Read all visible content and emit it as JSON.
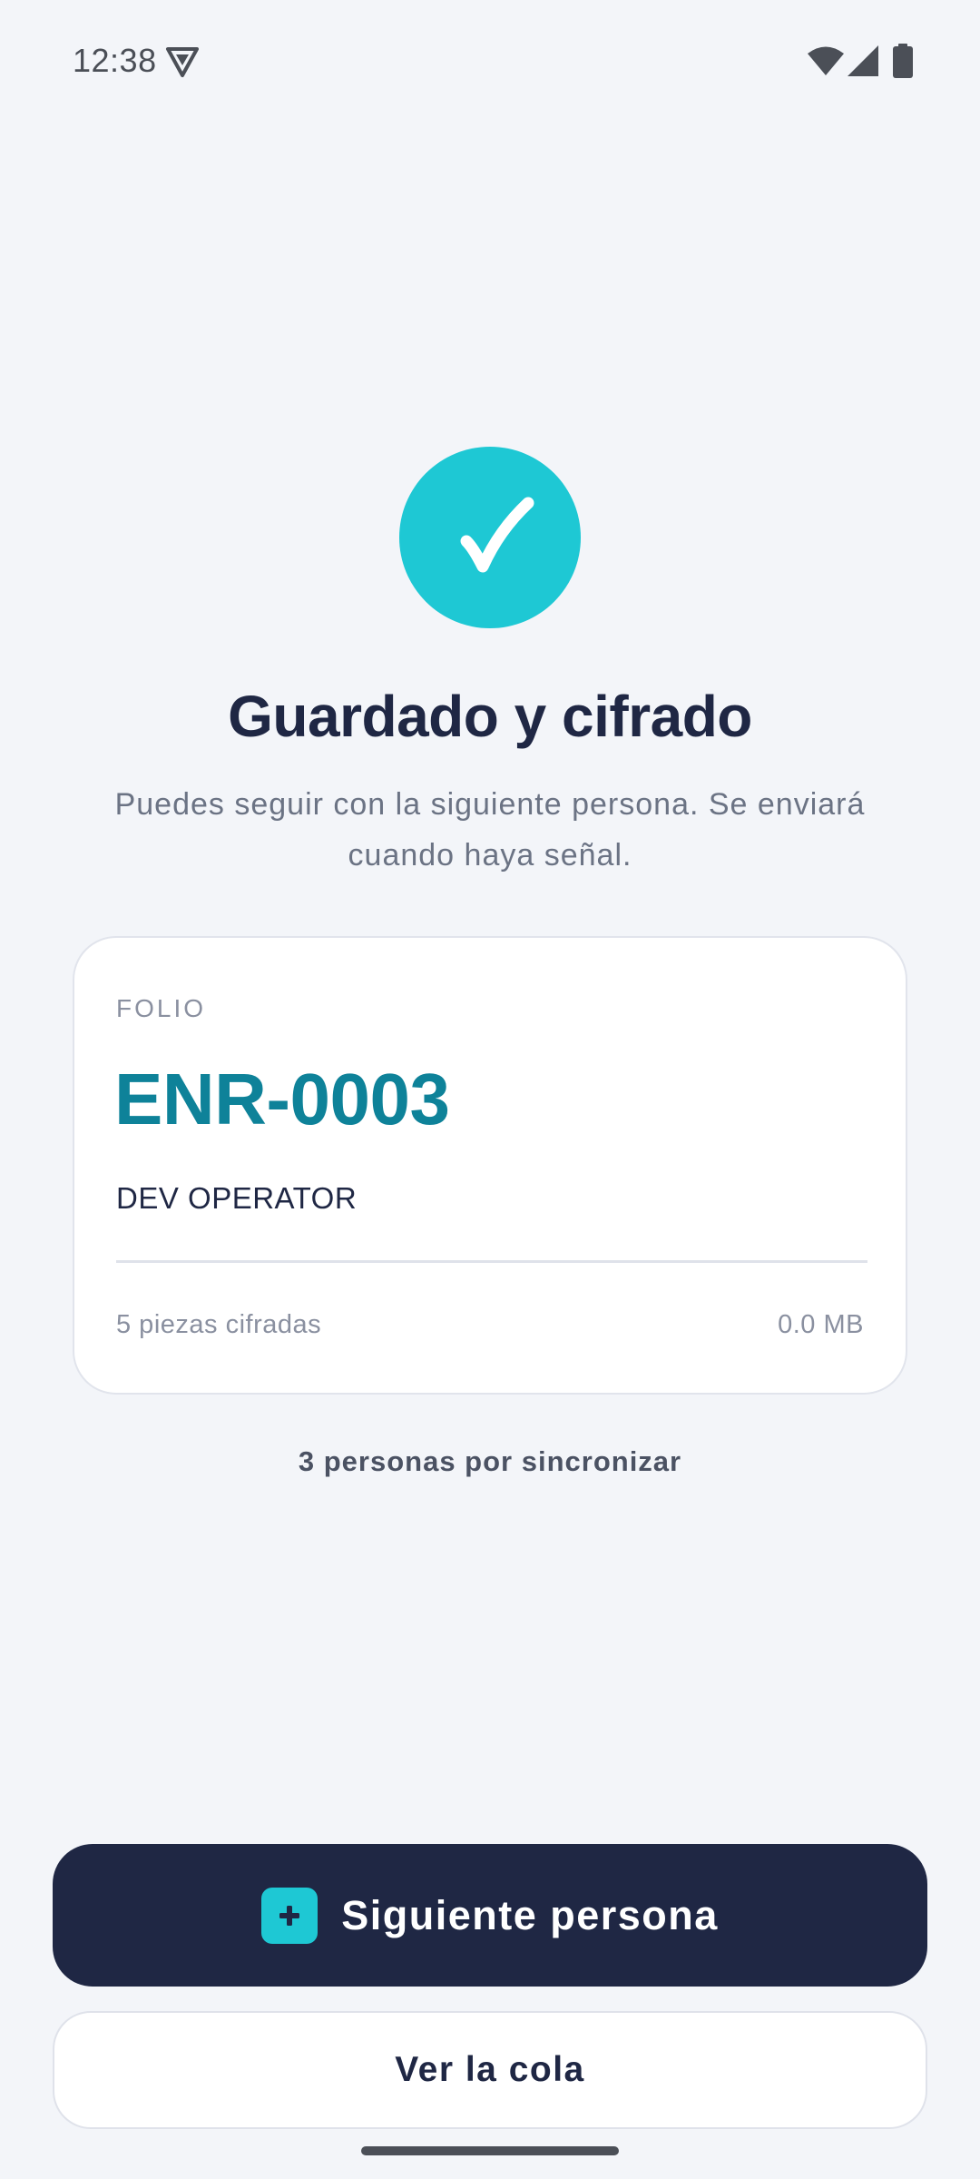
{
  "status_bar": {
    "time": "12:38",
    "icons": [
      "vpn-shield-icon",
      "wifi-icon",
      "signal-icon",
      "battery-icon"
    ]
  },
  "success": {
    "icon": "checkmark-icon",
    "title": "Guardado y cifrado",
    "subtitle": "Puedes seguir con la siguiente persona. Se enviará cuando haya señal."
  },
  "folio_card": {
    "label": "FOLIO",
    "folio_id": "ENR-0003",
    "operator": "DEV OPERATOR",
    "pieces": "5 piezas cifradas",
    "size": "0.0 MB"
  },
  "sync_status": "3 personas por sincronizar",
  "actions": {
    "next_person_label": "Siguiente persona",
    "next_person_icon": "plus-icon",
    "view_queue_label": "Ver la cola"
  },
  "colors": {
    "accent": "#1ec8d4",
    "navy": "#1f2744",
    "folio_teal": "#0e8299",
    "background": "#f3f5f9"
  }
}
